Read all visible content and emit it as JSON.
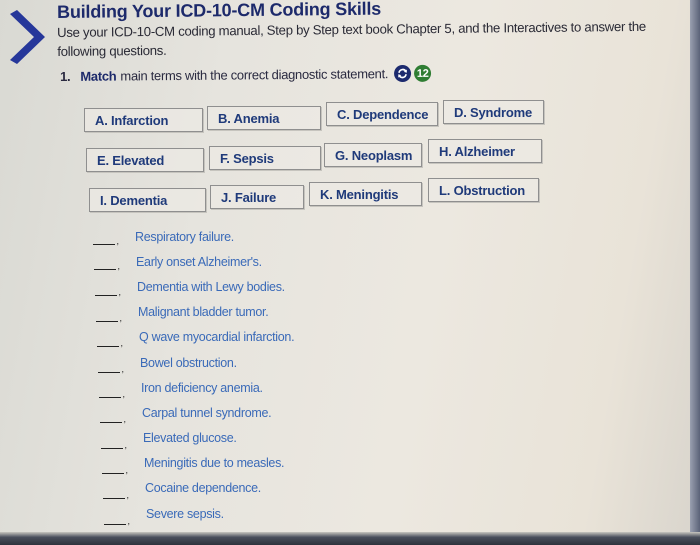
{
  "header": {
    "title": "Building Your ICD-10-CM Coding Skills",
    "instructions": "Use your ICD-10-CM coding manual, Step by Step text book Chapter 5, and the Interactives to answer the following questions."
  },
  "question": {
    "number": "1.",
    "keyword": "Match",
    "text": "main terms with the correct diagnostic statement.",
    "icons": {
      "refresh": "refresh-icon",
      "count": "12"
    }
  },
  "colors": {
    "title": "#1d2a6b",
    "term_text": "#1f3a7a",
    "statement_text": "#3a6ab8",
    "refresh_badge": "#1c2a6e",
    "count_badge": "#2f7d33",
    "chevron": "#26379a"
  },
  "terms": [
    {
      "label": "A. Infarction"
    },
    {
      "label": "B. Anemia"
    },
    {
      "label": "C. Dependence"
    },
    {
      "label": "D. Syndrome"
    },
    {
      "label": "E. Elevated"
    },
    {
      "label": "F. Sepsis"
    },
    {
      "label": "G. Neoplasm"
    },
    {
      "label": "H. Alzheimer"
    },
    {
      "label": "I. Dementia"
    },
    {
      "label": "J. Failure"
    },
    {
      "label": "K. Meningitis"
    },
    {
      "label": "L. Obstruction"
    }
  ],
  "statements": [
    {
      "answer": "",
      "text": "Respiratory failure."
    },
    {
      "answer": "",
      "text": "Early onset Alzheimer's."
    },
    {
      "answer": "",
      "text": "Dementia with Lewy bodies."
    },
    {
      "answer": "",
      "text": "Malignant bladder tumor."
    },
    {
      "answer": "",
      "text": "Q wave myocardial infarction."
    },
    {
      "answer": "",
      "text": "Bowel obstruction."
    },
    {
      "answer": "",
      "text": "Iron deficiency anemia."
    },
    {
      "answer": "",
      "text": "Carpal tunnel syndrome."
    },
    {
      "answer": "",
      "text": "Elevated glucose."
    },
    {
      "answer": "",
      "text": "Meningitis due to measles."
    },
    {
      "answer": "",
      "text": "Cocaine dependence."
    },
    {
      "answer": "",
      "text": "Severe sepsis."
    }
  ]
}
